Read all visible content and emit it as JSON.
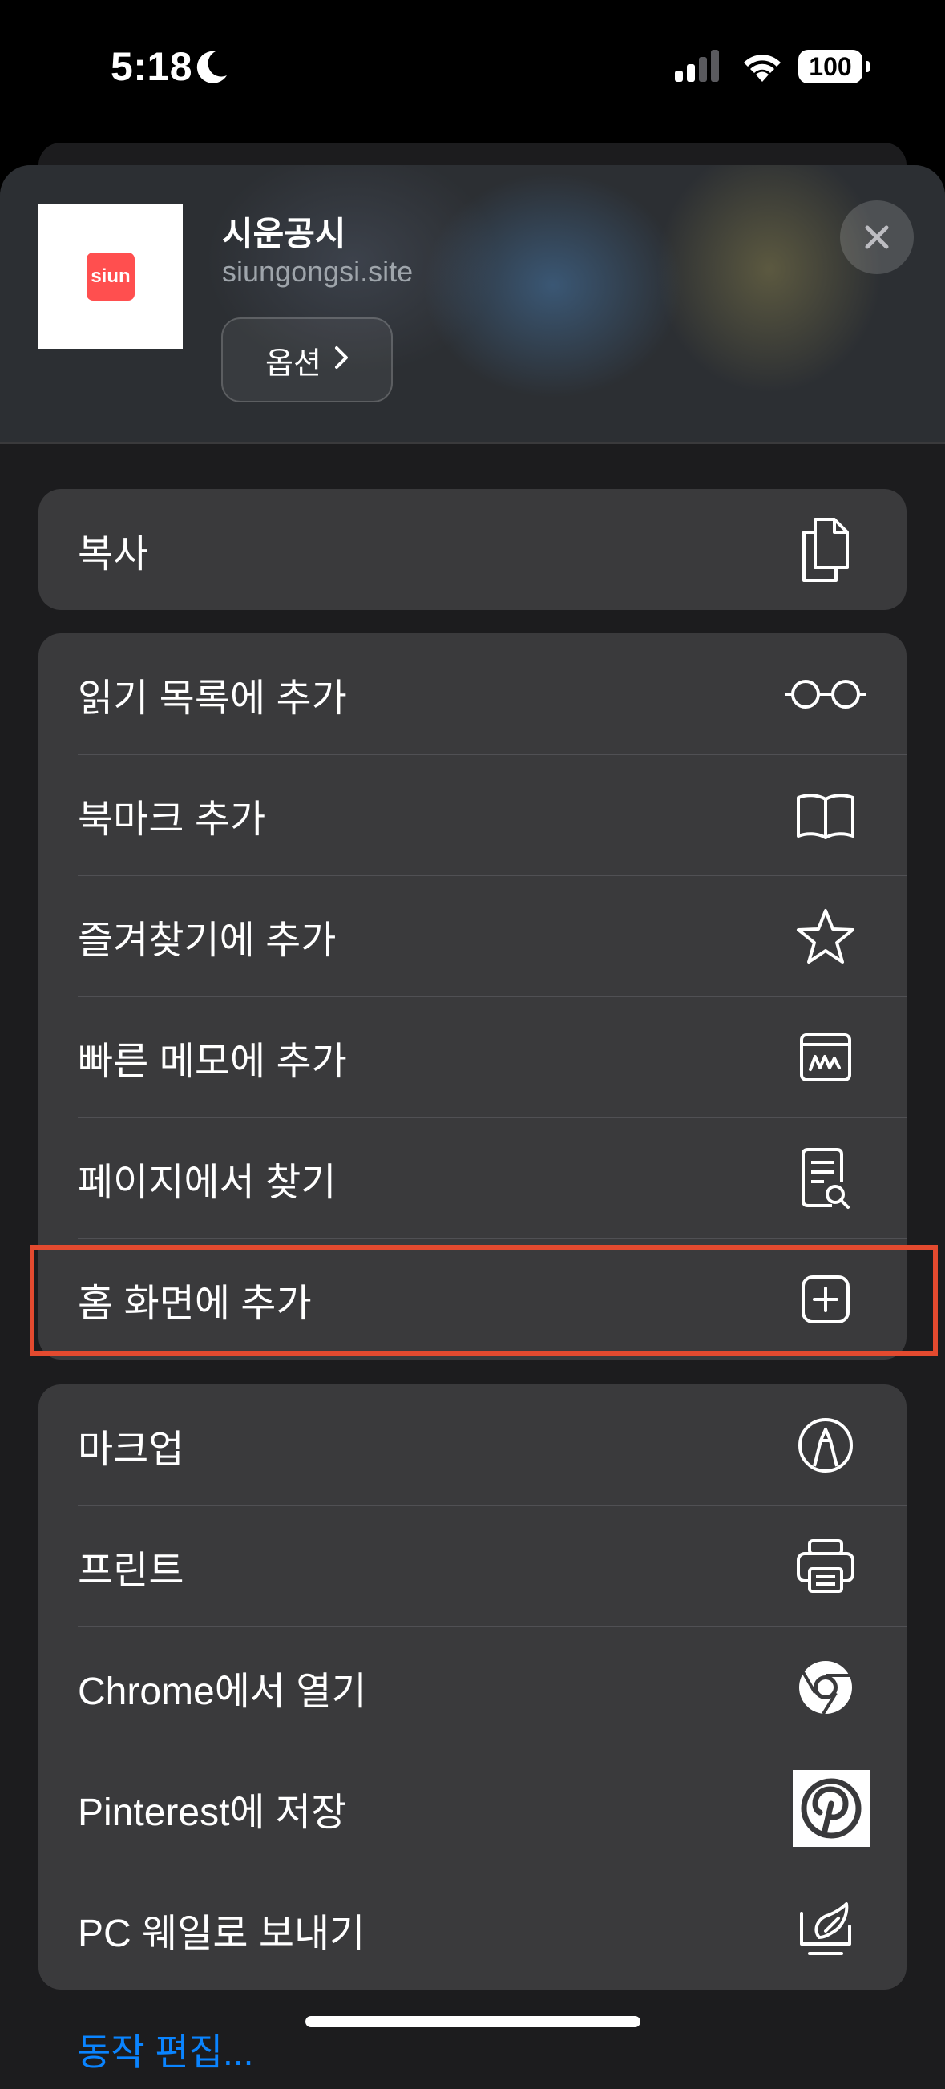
{
  "status_bar": {
    "time": "5:18",
    "battery": "100"
  },
  "header": {
    "site_name": "시운공시",
    "site_url": "siungongsi.site",
    "logo_text": "siun",
    "options_label": "옵션",
    "options_chevron": "›"
  },
  "groups": [
    {
      "items": [
        {
          "label": "복사",
          "icon": "copy-icon"
        }
      ]
    },
    {
      "items": [
        {
          "label": "읽기 목록에 추가",
          "icon": "glasses-icon"
        },
        {
          "label": "북마크 추가",
          "icon": "book-icon"
        },
        {
          "label": "즐겨찾기에 추가",
          "icon": "star-icon"
        },
        {
          "label": "빠른 메모에 추가",
          "icon": "quick-note-icon"
        },
        {
          "label": "페이지에서 찾기",
          "icon": "find-doc-icon"
        },
        {
          "label": "홈 화면에 추가",
          "icon": "add-square-icon"
        }
      ]
    },
    {
      "items": [
        {
          "label": "마크업",
          "icon": "markup-icon"
        },
        {
          "label": "프린트",
          "icon": "printer-icon"
        },
        {
          "label": "Chrome에서 열기",
          "icon": "chrome-icon"
        },
        {
          "label": "Pinterest에 저장",
          "icon": "pinterest-icon"
        },
        {
          "label": "PC 웨일로 보내기",
          "icon": "whale-icon"
        }
      ]
    }
  ],
  "footer": {
    "edit_actions": "동작 편집..."
  },
  "colors": {
    "highlight": "#e34a2f",
    "link": "#0a84ff",
    "row_bg": "#3a3a3c",
    "sheet_bg": "#1c1c1e"
  }
}
